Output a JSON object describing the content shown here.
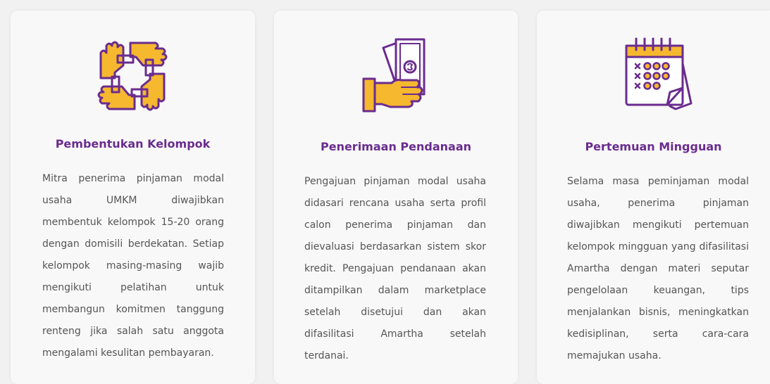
{
  "colors": {
    "accent_purple": "#6a2c8f",
    "accent_yellow": "#f5b82e",
    "text_gray": "#555555",
    "card_bg": "#f8f8f8"
  },
  "cards": [
    {
      "icon": "hands-teamwork-icon",
      "title": "Pembentukan Kelompok",
      "description": "Mitra penerima pinjaman modal usaha UMKM diwajibkan membentuk kelompok 15-20 orang dengan domisili berdekatan. Setiap kelompok masing-masing wajib mengikuti pelatihan untuk membangun komitmen tanggung renteng jika salah satu anggota mengalami kesulitan pembayaran."
    },
    {
      "icon": "hand-money-icon",
      "title": "Penerimaan Pendanaan",
      "description": "Pengajuan pinjaman modal usaha didasari rencana usaha serta profil calon penerima pinjaman dan dievaluasi berdasarkan sistem skor kredit. Pengajuan pendanaan akan ditampilkan dalam marketplace setelah disetujui dan akan difasilitasi Amartha setelah terdanai."
    },
    {
      "icon": "calendar-icon",
      "title": "Pertemuan Mingguan",
      "description": "Selama masa peminjaman modal usaha, penerima pinjaman diwajibkan mengikuti pertemuan kelompok mingguan yang difasilitasi Amartha dengan materi seputar pengelolaan keuangan, tips menjalankan bisnis, meningkatkan kedisiplinan, serta cara-cara memajukan usaha."
    }
  ]
}
